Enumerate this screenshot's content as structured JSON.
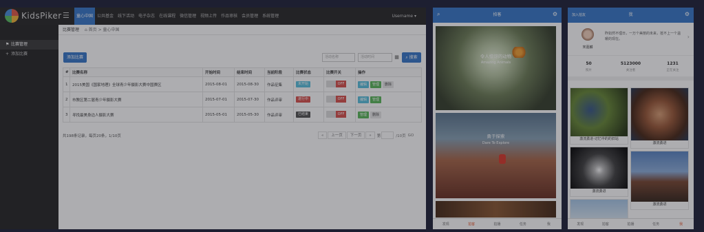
{
  "admin": {
    "brand": "KidsPiker",
    "menu_icon": "hamburger-icon",
    "nav": [
      "童心中国",
      "公共基金",
      "线下活动",
      "电子杂志",
      "在线课程",
      "微信管理",
      "视频上传",
      "作品审核",
      "会员管理",
      "系统管理"
    ],
    "user": "Username ▾",
    "sidebar": [
      {
        "label": "比赛管理",
        "icon": "flag-icon"
      },
      {
        "label": "添加比赛",
        "icon": "plus-icon"
      }
    ],
    "breadcrumb": {
      "title": "比赛管理",
      "home": "⌂ 首页",
      "sep": ">",
      "current": "童心中国"
    },
    "add_button": "添加比赛",
    "search": {
      "name_placeholder": "活动名称",
      "time_placeholder": "活动时间",
      "button": "搜索",
      "button_icon": "search-icon",
      "calendar_icon": "calendar-icon"
    },
    "table": {
      "headers": [
        "#",
        "比赛名称",
        "开始时间",
        "结束时间",
        "当前阶段",
        "比赛状态",
        "比赛开关",
        "操作"
      ],
      "rows": [
        {
          "no": "1",
          "name": "2015美国《国家地理》全球青少年摄影大赛中国赛区",
          "start": "2015-08-01",
          "end": "2015-08-30",
          "stage": "作品征集",
          "status": "未开始",
          "status_color": "#5bc0de",
          "switch": "OFF",
          "ops": [
            {
              "label": "编辑",
              "color": "#5bc0de"
            },
            {
              "label": "管理",
              "color": "#5cb85c"
            },
            {
              "label": "删除",
              "color": "#e6e6e6"
            }
          ]
        },
        {
          "no": "2",
          "name": "市教区第二届青少年摄影大赛",
          "start": "2015-07-01",
          "end": "2015-07-30",
          "stage": "作品评审",
          "status": "进行中",
          "status_color": "#d9534f",
          "switch": "OFF",
          "ops": [
            {
              "label": "编辑",
              "color": "#5bc0de"
            },
            {
              "label": "管理",
              "color": "#5cb85c"
            }
          ]
        },
        {
          "no": "3",
          "name": "寻找最美身边人摄影大赛",
          "start": "2015-05-01",
          "end": "2015-05-30",
          "stage": "作品评审",
          "status": "已结束",
          "status_color": "#555555",
          "switch": "OFF",
          "ops": [
            {
              "label": "管理",
              "color": "#5cb85c"
            },
            {
              "label": "删除",
              "color": "#e6e6e6"
            }
          ]
        }
      ]
    },
    "pagination": {
      "info": "共198条记录，每页20条，1/10页",
      "first": "«",
      "prev": "上一页",
      "next": "下一页",
      "last": "»",
      "goto_prefix": "第",
      "goto_suffix": "/10页",
      "go": "GO"
    }
  },
  "phone1": {
    "title": "拍客",
    "left_icon": "search-icon",
    "right_icon": "settings-icon",
    "cards": [
      {
        "title": "令人惊讶的动物",
        "subtitle": "Amazing Animals"
      },
      {
        "title": "勇于探索",
        "subtitle": "Dare To Explore"
      }
    ],
    "tabs": [
      "发现",
      "拍客",
      "拍播",
      "任务",
      "我"
    ],
    "active_tab": 1
  },
  "phone2": {
    "title": "我",
    "left_label": "加入拍友",
    "right_icon": "settings-icon",
    "username": "宋嘉麟",
    "bio": "昨如然不理日，一万个美丽的未来，抵不上一个温暖的现在。",
    "stats": [
      {
        "value": "50",
        "label": "照片"
      },
      {
        "value": "5123000",
        "label": "关注者"
      },
      {
        "value": "1231",
        "label": "正在关注"
      }
    ],
    "tiles": [
      {
        "caption": "激流勇进·记忆中的的旧站"
      },
      {
        "caption": "激流勇进"
      },
      {
        "caption": "激流勇进"
      },
      {
        "caption": "激流勇进"
      }
    ],
    "tabs": [
      "发现",
      "拍客",
      "拍播",
      "任务",
      "我"
    ],
    "active_tab": 4
  }
}
